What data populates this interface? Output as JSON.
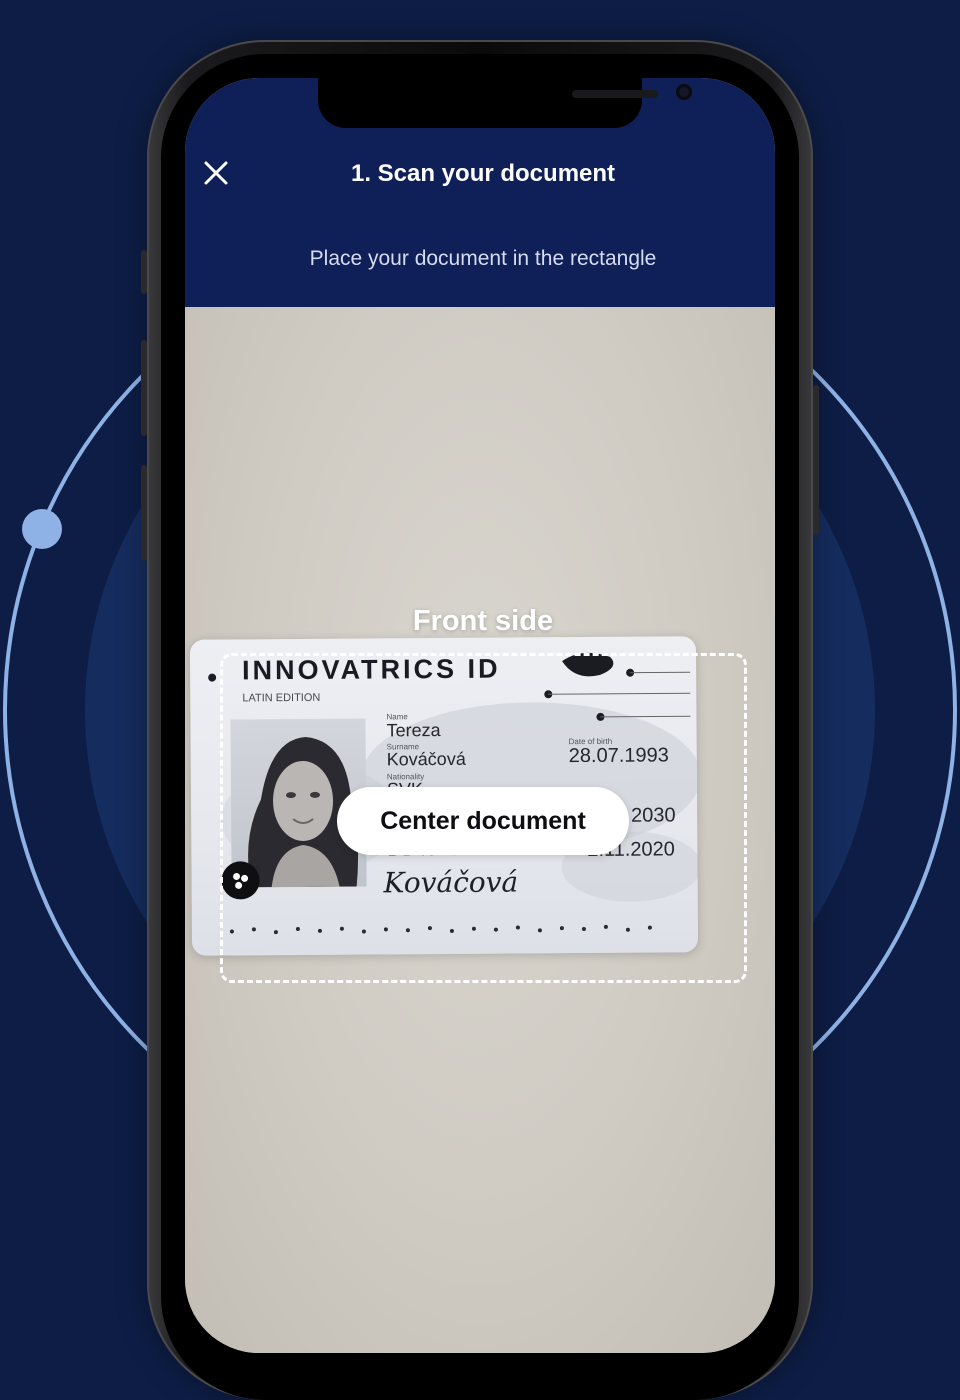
{
  "header": {
    "title": "1. Scan your document",
    "subtitle": "Place your document in the rectangle"
  },
  "scanner": {
    "side_label": "Front side",
    "status_button": "Center document"
  },
  "id_card": {
    "brand": "INNOVATRICS ID",
    "edition": "LATIN EDITION",
    "name_label": "Name",
    "name": "Tereza",
    "surname_label": "Surname",
    "surname": "Kováčová",
    "nationality_label": "Nationality",
    "nationality": "SVK",
    "dob_label": "Date of birth",
    "dob": "28.07.1993",
    "expiry": "2030",
    "issue_date": "2.11.2020",
    "doc_number": "DB491384",
    "signature": "Kováčová"
  },
  "icons": {
    "close": "close-icon",
    "card_badge": "innovatrics-logo-icon"
  },
  "colors": {
    "background": "#0d1d45",
    "header": "#0f1f57",
    "orbit": "#8fb2e6",
    "frame": "#ffffff"
  }
}
